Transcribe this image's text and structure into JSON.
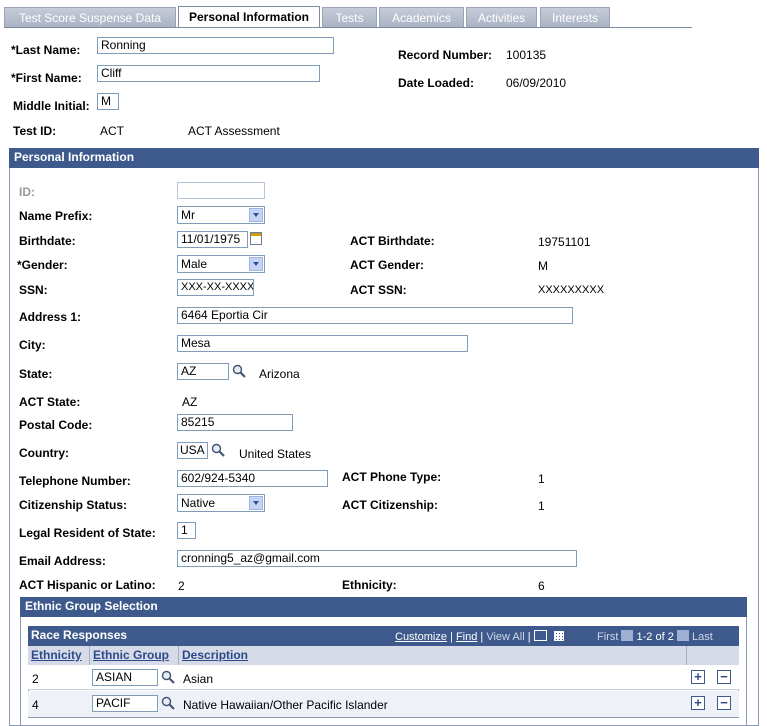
{
  "tabs": [
    "Test Score Suspense Data",
    "Personal Information",
    "Tests",
    "Academics",
    "Activities",
    "Interests"
  ],
  "header": {
    "last_name_label": "*Last Name:",
    "last_name": "Ronning",
    "first_name_label": "*First Name:",
    "first_name": "Cliff",
    "middle_initial_label": "Middle Initial:",
    "middle_initial": "M",
    "test_id_label": "Test ID:",
    "test_id": "ACT",
    "test_desc": "ACT Assessment",
    "record_number_label": "Record Number:",
    "record_number": "100135",
    "date_loaded_label": "Date Loaded:",
    "date_loaded": "06/09/2010"
  },
  "section": {
    "title": "Personal Information",
    "id_label": "ID:",
    "id_value": "",
    "name_prefix_label": "Name Prefix:",
    "name_prefix": "Mr",
    "birthdate_label": "Birthdate:",
    "birthdate": "11/01/1975",
    "act_birthdate_label": "ACT Birthdate:",
    "act_birthdate": "19751101",
    "gender_label": "*Gender:",
    "gender": "Male",
    "act_gender_label": "ACT Gender:",
    "act_gender": "M",
    "ssn_label": "SSN:",
    "ssn": "XXX-XX-XXXX",
    "act_ssn_label": "ACT SSN:",
    "act_ssn": "XXXXXXXXX",
    "address1_label": "Address 1:",
    "address1": "6464 Eportia Cir",
    "city_label": "City:",
    "city": "Mesa",
    "state_label": "State:",
    "state": "AZ",
    "state_desc": "Arizona",
    "act_state_label": "ACT State:",
    "act_state": "AZ",
    "postal_label": "Postal Code:",
    "postal": "85215",
    "country_label": "Country:",
    "country": "USA",
    "country_desc": "United States",
    "phone_label": "Telephone Number:",
    "phone": "602/924-5340",
    "act_phone_type_label": "ACT Phone Type:",
    "act_phone_type": "1",
    "citizenship_label": "Citizenship Status:",
    "citizenship": "Native",
    "act_citizenship_label": "ACT Citizenship:",
    "act_citizenship": "1",
    "legal_res_label": "Legal Resident of State:",
    "legal_res": "1",
    "email_label": "Email Address:",
    "email": "cronning5_az@gmail.com",
    "act_hispanic_label": "ACT Hispanic or Latino:",
    "act_hispanic": "2",
    "ethnicity_label": "Ethnicity:",
    "ethnicity": "6"
  },
  "ethnic_group": {
    "title": "Ethnic Group Selection",
    "grid_title": "Race Responses",
    "customize": "Customize",
    "find": "Find",
    "view_all": "View All",
    "first": "First",
    "range": "1-2 of 2",
    "last": "Last",
    "columns": [
      "Ethnicity",
      "Ethnic Group",
      "Description"
    ],
    "rows": [
      {
        "ethnicity": "2",
        "group": "ASIAN",
        "description": "Asian"
      },
      {
        "ethnicity": "4",
        "group": "PACIF",
        "description": "Native Hawaiian/Other Pacific Islander"
      }
    ]
  }
}
